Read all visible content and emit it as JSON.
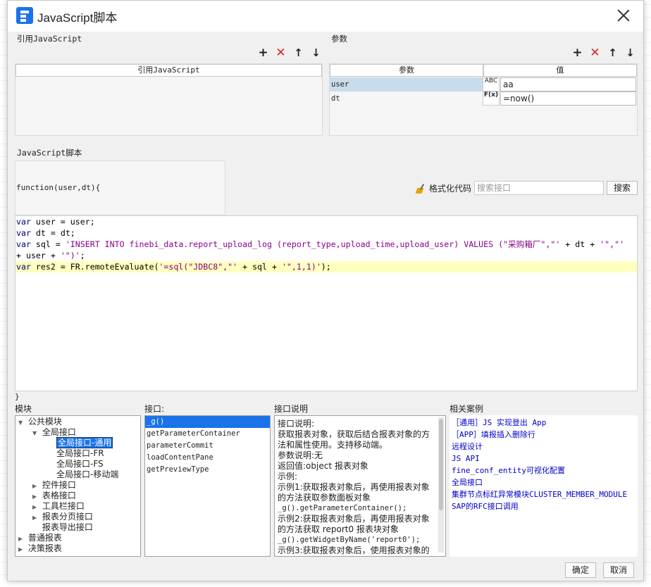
{
  "window": {
    "title": "JavaScript脚本"
  },
  "ref_js": {
    "section_label": "引用JavaScript",
    "column_header": "引用JavaScript"
  },
  "params": {
    "section_label": "参数",
    "col_name": "参数",
    "col_value": "值",
    "rows": [
      {
        "name": "user",
        "type_icon": "ABC",
        "value": "aa"
      },
      {
        "name": "dt",
        "type_icon": "F(x)",
        "value": "=now()"
      }
    ]
  },
  "toolbar": {
    "add": "+",
    "delete": "✕",
    "up": "↑",
    "down": "↓"
  },
  "script": {
    "section_label": "JavaScript脚本",
    "signature": "function(user,dt){",
    "format_label": "格式化代码",
    "search_placeholder": "搜索接口",
    "search_button": "搜索",
    "closing_brace": "}"
  },
  "code": {
    "lines": [
      "var user = user;",
      "var dt = dt;",
      "var sql = 'INSERT INTO finebi_data.report_upload_log (report_type,upload_time,upload_user) VALUES (\"采购箱厂\",\"' + dt + '\",\"'",
      "+ user + '\")';",
      "var res2 = FR.remoteEvaluate('=sql(\"JDBC8\",\"' + sql + '\",1,1)');"
    ]
  },
  "bottom": {
    "module_label": "模块",
    "iface_label": "接口:",
    "doc_label": "接口说明",
    "cases_label": "相关案例",
    "tree": [
      {
        "label": "公共模块",
        "toggle": "▼",
        "level": 0
      },
      {
        "label": "全局接口",
        "toggle": "▼",
        "level": 1
      },
      {
        "label": "全局接口-通用",
        "toggle": "",
        "level": 2,
        "selected": true
      },
      {
        "label": "全局接口-FR",
        "toggle": "",
        "level": 2
      },
      {
        "label": "全局接口-FS",
        "toggle": "",
        "level": 2
      },
      {
        "label": "全局接口-移动端",
        "toggle": "",
        "level": 2
      },
      {
        "label": "控件接口",
        "toggle": "▶",
        "level": 1
      },
      {
        "label": "表格接口",
        "toggle": "▶",
        "level": 1
      },
      {
        "label": "工具栏接口",
        "toggle": "▶",
        "level": 1
      },
      {
        "label": "报表分页接口",
        "toggle": "▶",
        "level": 1
      },
      {
        "label": "报表导出接口",
        "toggle": "",
        "level": 1
      },
      {
        "label": "普通报表",
        "toggle": "▶",
        "level": 0
      },
      {
        "label": "决策报表",
        "toggle": "▶",
        "level": 0
      }
    ],
    "interfaces": [
      "_g()",
      "getParameterContainer",
      "parameterCommit",
      "loadContentPane",
      "getPreviewType"
    ],
    "doc_lines": [
      "接口说明:",
      "获取报表对象，获取后结合报表对象的方",
      "法和属性使用。支持移动端。",
      "参数说明:无",
      "返回值:object 报表对象",
      "示例:",
      "示例1:获取报表对象后，再使用报表对象",
      "的方法获取参数面板对象",
      "_g().getParameterContainer();",
      "示例2:获取报表对象后，再使用报表对象",
      "的方法获取 report0 报表块对象",
      "_g().getWidgetByName('report0');",
      "示例3:获取报表对象后，使用报表对象的"
    ],
    "cases": [
      "［通用］JS 实现登出 App",
      "［APP］填报插入删除行",
      "远程设计",
      "JS API",
      "fine_conf_entity可视化配置",
      "全局接口",
      "集群节点标红异常模块CLUSTER_MEMBER_MODULE",
      "SAP的RFC接口调用"
    ]
  },
  "footer": {
    "ok": "确定",
    "cancel": "取消"
  },
  "colors": {
    "accent": "#1a73e8",
    "delete_red": "#e02020",
    "keyword": "#00008b",
    "string": "#8b008b",
    "line_highlight": "#ffffc0"
  }
}
